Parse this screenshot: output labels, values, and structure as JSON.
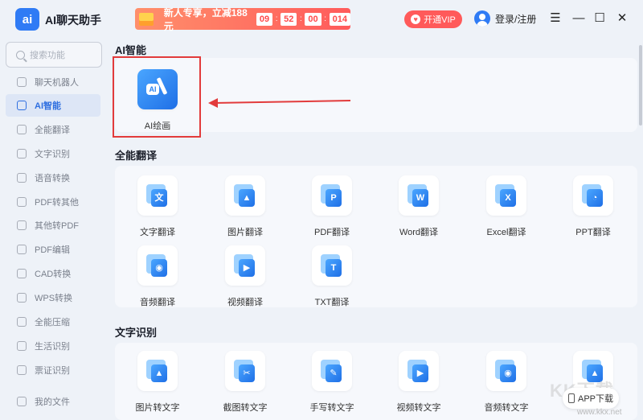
{
  "app": {
    "logo_text": "ai",
    "name": "AI聊天助手"
  },
  "promo": {
    "text": "新人专享，立减188元",
    "timer": [
      "09",
      "52",
      "00",
      "014"
    ]
  },
  "header": {
    "vip_label": "开通VIP",
    "login_label": "登录/注册"
  },
  "window_controls": {
    "menu": "☰",
    "minimize": "—",
    "maximize": "☐",
    "close": "✕"
  },
  "search": {
    "placeholder": "搜索功能"
  },
  "sidebar": {
    "items": [
      {
        "label": "聊天机器人",
        "icon": "robot-icon"
      },
      {
        "label": "AI智能",
        "icon": "ai-icon",
        "active": true
      },
      {
        "label": "全能翻译",
        "icon": "translate-icon"
      },
      {
        "label": "文字识别",
        "icon": "ocr-icon"
      },
      {
        "label": "语音转换",
        "icon": "voice-icon"
      },
      {
        "label": "PDF转其他",
        "icon": "pdf-icon"
      },
      {
        "label": "其他转PDF",
        "icon": "to-pdf-icon"
      },
      {
        "label": "PDF编辑",
        "icon": "pdf-edit-icon"
      },
      {
        "label": "CAD转换",
        "icon": "cad-icon"
      },
      {
        "label": "WPS转换",
        "icon": "wps-icon"
      },
      {
        "label": "全能压缩",
        "icon": "compress-icon"
      },
      {
        "label": "生活识别",
        "icon": "life-icon"
      },
      {
        "label": "票证识别",
        "icon": "ticket-icon"
      }
    ],
    "my_files": "我的文件"
  },
  "sections": {
    "ai": {
      "title": "AI智能",
      "tiles": [
        {
          "label": "AI绘画",
          "glyph": "AI"
        }
      ]
    },
    "translate": {
      "title": "全能翻译",
      "tiles": [
        {
          "label": "文字翻译",
          "glyph": "文"
        },
        {
          "label": "图片翻译",
          "glyph": "▲"
        },
        {
          "label": "PDF翻译",
          "glyph": "P"
        },
        {
          "label": "Word翻译",
          "glyph": "W"
        },
        {
          "label": "Excel翻译",
          "glyph": "X"
        },
        {
          "label": "PPT翻译",
          "glyph": "◔"
        },
        {
          "label": "音频翻译",
          "glyph": "◉"
        },
        {
          "label": "视频翻译",
          "glyph": "▶"
        },
        {
          "label": "TXT翻译",
          "glyph": "T"
        }
      ]
    },
    "ocr": {
      "title": "文字识别",
      "tiles": [
        {
          "label": "图片转文字",
          "glyph": "▲"
        },
        {
          "label": "截图转文字",
          "glyph": "✂"
        },
        {
          "label": "手写转文字",
          "glyph": "✎"
        },
        {
          "label": "视频转文字",
          "glyph": "▶"
        },
        {
          "label": "音频转文字",
          "glyph": "◉"
        },
        {
          "label": "",
          "glyph": "▲"
        }
      ]
    }
  },
  "app_download": {
    "label": "APP下载"
  },
  "watermark": {
    "brand": "KK下载",
    "url": "www.kkx.net"
  },
  "colors": {
    "accent": "#2f7bf5",
    "highlight": "#e23b3b",
    "promo": "#ff5b5b"
  }
}
